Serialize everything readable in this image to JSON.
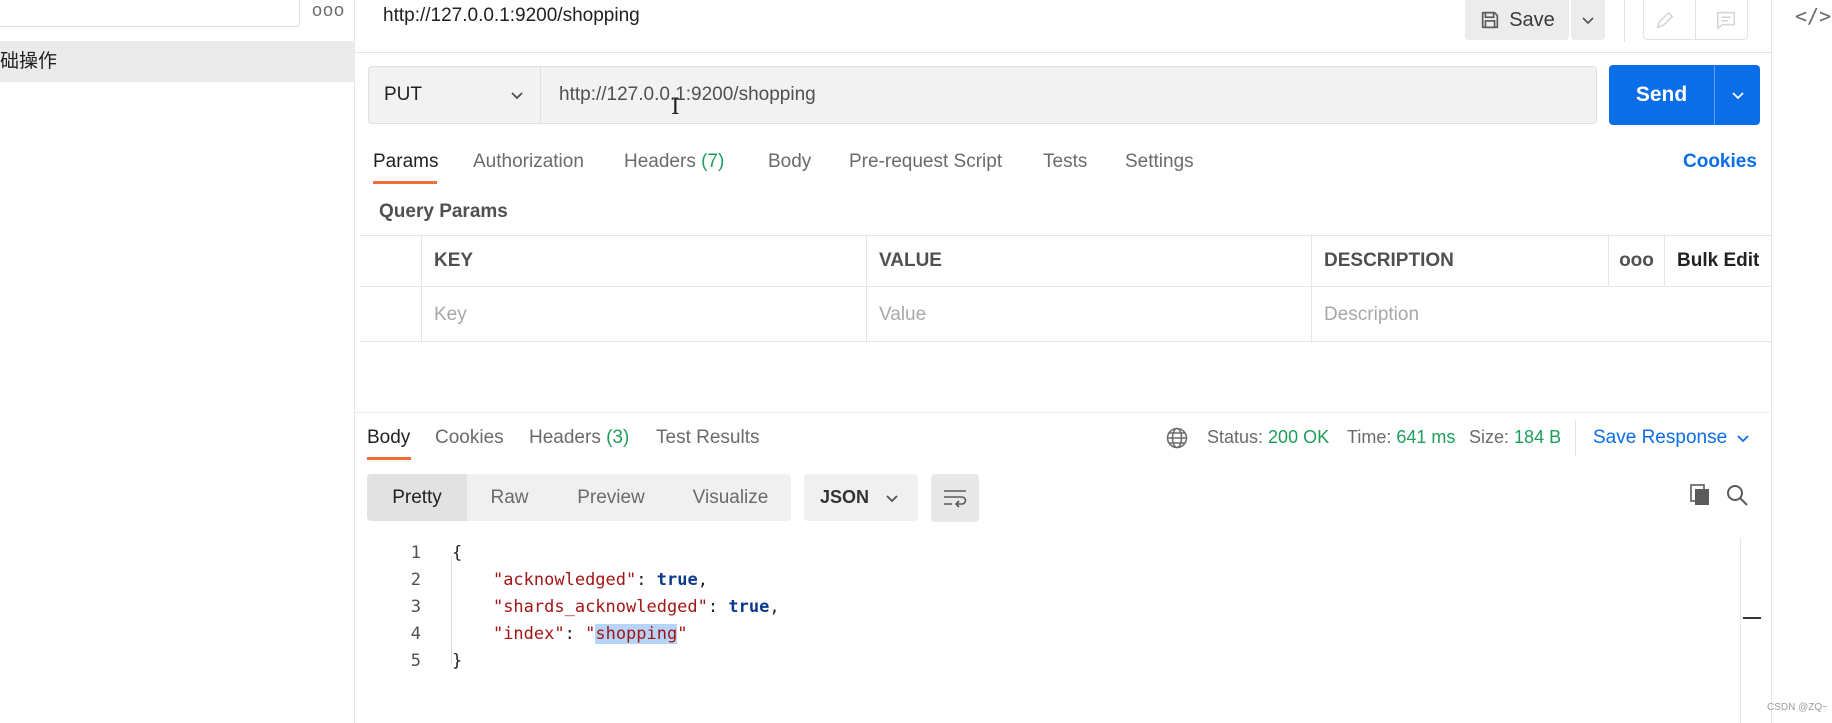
{
  "sidebar": {
    "more_label": "ooo",
    "folder_label": "础操作"
  },
  "header": {
    "request_title": "http://127.0.0.1:9200/shopping",
    "save_label": "Save"
  },
  "request": {
    "method": "PUT",
    "url": "http://127.0.0.1:9200/shopping",
    "send_label": "Send",
    "tabs": [
      {
        "label": "Params",
        "count": ""
      },
      {
        "label": "Authorization",
        "count": ""
      },
      {
        "label": "Headers",
        "count": "(7)"
      },
      {
        "label": "Body",
        "count": ""
      },
      {
        "label": "Pre-request Script",
        "count": ""
      },
      {
        "label": "Tests",
        "count": ""
      },
      {
        "label": "Settings",
        "count": ""
      }
    ],
    "cookies_label": "Cookies",
    "query_params_title": "Query Params",
    "table": {
      "headers": [
        "KEY",
        "VALUE",
        "DESCRIPTION"
      ],
      "more_label": "ooo",
      "bulk_edit_label": "Bulk Edit",
      "placeholders": [
        "Key",
        "Value",
        "Description"
      ]
    }
  },
  "response": {
    "tabs": [
      {
        "label": "Body",
        "count": ""
      },
      {
        "label": "Cookies",
        "count": ""
      },
      {
        "label": "Headers",
        "count": "(3)"
      },
      {
        "label": "Test Results",
        "count": ""
      }
    ],
    "status_label": "Status:",
    "status_value": "200 OK",
    "time_label": "Time:",
    "time_value": "641 ms",
    "size_label": "Size:",
    "size_value": "184 B",
    "save_response_label": "Save Response",
    "formats": [
      "Pretty",
      "Raw",
      "Preview",
      "Visualize"
    ],
    "language": "JSON",
    "code_lines": [
      "1",
      "2",
      "3",
      "4",
      "5"
    ],
    "code": {
      "open": "{",
      "k1": "\"acknowledged\"",
      "v1": "true",
      "k2": "\"shards_acknowledged\"",
      "v2": "true",
      "k3": "\"index\"",
      "v3_open": "\"",
      "v3": "shopping",
      "v3_close": "\"",
      "close": "}"
    }
  },
  "watermark": "CSDN @ZQ~",
  "colors": {
    "accent": "#0b6ee8",
    "tab_underline": "#f26b3a",
    "count_green": "#1e9e5b"
  }
}
